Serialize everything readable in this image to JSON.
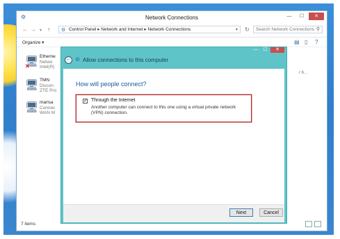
{
  "explorer": {
    "title": "Network Connections",
    "address": "Control Panel  ▸  Network and Internet  ▸  Network Connections",
    "search_placeholder": "Search Network Connections",
    "organize_label": "Organize ▾",
    "status": "7 items",
    "right_fragment": "r 6...",
    "items": [
      {
        "name": "Etherne",
        "line1": "Netwo",
        "line2": "Intel(R)"
      },
      {
        "name": "TMN",
        "line1": "Discon",
        "line2": "ZTE Pro"
      },
      {
        "name": "marisa",
        "line1": "Connec",
        "line2": "WAN M"
      }
    ]
  },
  "wizard": {
    "title": "Allow connections to this computer",
    "heading": "How will people connect?",
    "option_label": "Through the Internet",
    "option_checked": true,
    "option_description": "Another computer can connect to this one using a virtual private network (VPN) connection.",
    "next_label": "Next",
    "cancel_label": "Cancel"
  },
  "colors": {
    "wizard_border": "#5fc4c8",
    "highlight_box": "#b32424",
    "heading": "#1a5a9a",
    "desktop": "#3b8fd8"
  }
}
